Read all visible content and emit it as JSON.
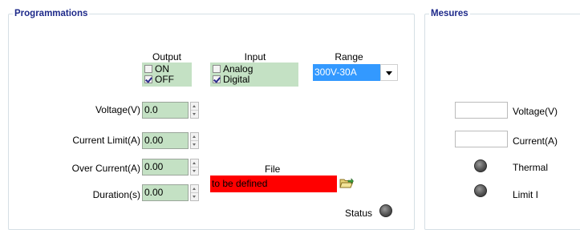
{
  "programmations": {
    "title": "Programmations",
    "output": {
      "header": "Output",
      "options": [
        {
          "label": "ON",
          "checked": false
        },
        {
          "label": "OFF",
          "checked": true
        }
      ]
    },
    "input": {
      "header": "Input",
      "options": [
        {
          "label": "Analog",
          "checked": false
        },
        {
          "label": "Digital",
          "checked": true
        }
      ]
    },
    "range": {
      "header": "Range",
      "selected": "300V-30A"
    },
    "fields": [
      {
        "label": "Voltage(V)",
        "value": "0.0"
      },
      {
        "label": "Current Limit(A)",
        "value": "0.00"
      },
      {
        "label": "Over Current(A)",
        "value": "0.00"
      },
      {
        "label": "Duration(s)",
        "value": "0.00"
      }
    ],
    "file": {
      "label": "File",
      "value": "to be defined"
    },
    "status_label": "Status"
  },
  "mesures": {
    "title": "Mesures",
    "voltage_label": "Voltage(V)",
    "current_label": "Current(A)",
    "thermal_label": "Thermal",
    "limit_label": "Limit I"
  },
  "colors": {
    "group_title": "#1e2a8a",
    "field_bg": "#c4e1c4",
    "file_bg": "#ff0000",
    "selection": "#3399ff"
  }
}
